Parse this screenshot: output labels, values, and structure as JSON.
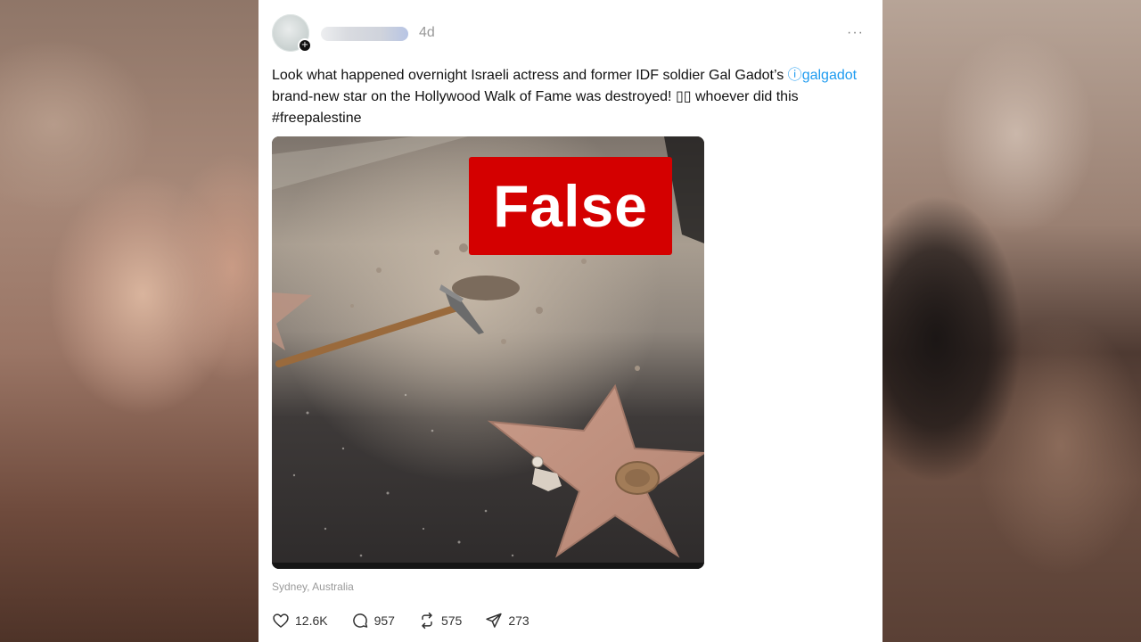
{
  "post": {
    "time": "4d",
    "more": "···",
    "avatar_badge": "+",
    "text_part1": "Look what happened overnight Israeli actress and former IDF soldier Gal Gadot’s ",
    "mention_icon": "ⓘ",
    "mention_handle": "galgadot",
    "text_part2": " brand-new star on the Hollywood Walk of Fame was destroyed! ▯▯ whoever did this #freepalestine",
    "overlay_label": "False",
    "location": "Sydney, Australia",
    "stats": {
      "likes": "12.6K",
      "replies": "957",
      "reposts": "575",
      "shares": "273"
    }
  },
  "icons": {
    "like": "heart-icon",
    "reply": "comment-icon",
    "repost": "repost-icon",
    "share": "send-icon"
  },
  "colors": {
    "label_red": "#d40000",
    "mention_blue": "#1d9bf0"
  }
}
